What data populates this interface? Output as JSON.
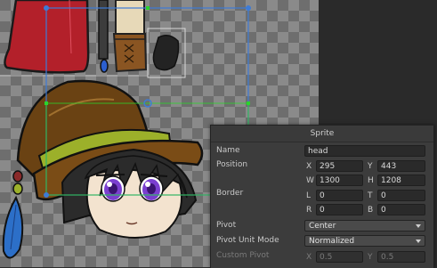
{
  "panel": {
    "title": "Sprite",
    "name_label": "Name",
    "name_value": "head",
    "position_label": "Position",
    "x_label": "X",
    "x_value": "295",
    "y_label": "Y",
    "y_value": "443",
    "w_label": "W",
    "w_value": "1300",
    "h_label": "H",
    "h_value": "1208",
    "border_label": "Border",
    "l_label": "L",
    "l_value": "0",
    "t_label": "T",
    "t_value": "0",
    "r_label": "R",
    "r_value": "0",
    "b_label": "B",
    "b_value": "0",
    "pivot_label": "Pivot",
    "pivot_value": "Center",
    "pivot_unit_label": "Pivot Unit Mode",
    "pivot_unit_value": "Normalized",
    "custom_pivot_label": "Custom Pivot",
    "cp_x_label": "X",
    "cp_x_value": "0.5",
    "cp_y_label": "Y",
    "cp_y_value": "0.5"
  },
  "colors": {
    "selection_rect": "#3d7bd6",
    "border_handle": "#2bd42b",
    "hat": "#6a4213",
    "hat_band": "#9cb02a",
    "skin": "#f3e3cf",
    "hair": "#2b2b2b",
    "eye": "#7b3fd0",
    "cape": "#b3202a",
    "feather": "#2c6fc8"
  }
}
